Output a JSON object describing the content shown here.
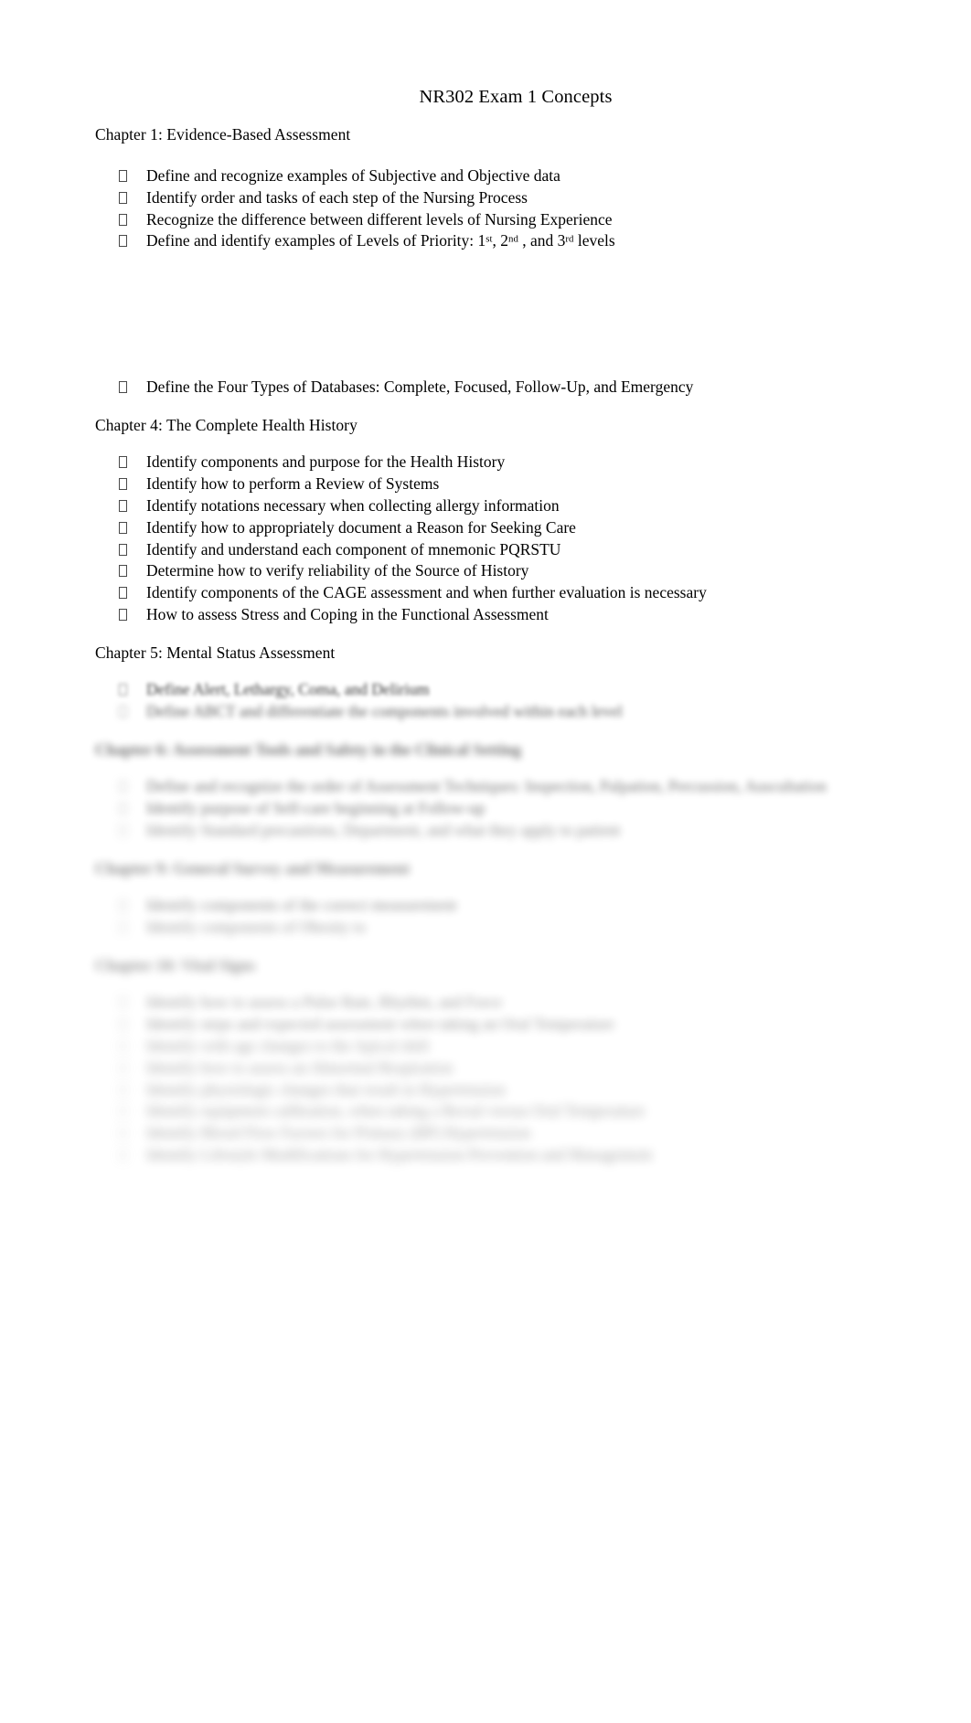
{
  "document": {
    "title": "NR302 Exam 1 Concepts",
    "bullet_glyph": "empty-box-glyph"
  },
  "sections": {
    "chapter1": {
      "heading": "Chapter 1: Evidence-Based Assessment",
      "bullets": [
        "Define and recognize examples of Subjective and Objective data",
        "Identify order and tasks of each step of the Nursing Process",
        "Recognize the difference between different levels of Nursing Experience"
      ],
      "priority_bullet": {
        "lead": "Define and identify examples of Levels of Priority: 1",
        "sup1": "st",
        "mid1": ", 2",
        "sup2": "nd",
        "mid2": " , and 3",
        "sup3": "rd",
        "tail": " levels"
      },
      "databases_bullet": "Define the Four Types of Databases: Complete, Focused, Follow-Up, and Emergency"
    },
    "chapter4": {
      "heading": "Chapter 4: The Complete Health History",
      "bullets": [
        "Identify components and purpose for the Health History",
        "Identify how to perform a Review of Systems",
        "Identify notations necessary when collecting allergy information",
        "Identify how to appropriately document a Reason for Seeking Care",
        "Identify and understand each component of mnemonic PQRSTU",
        "Determine how to verify reliability of the Source of History",
        "Identify components of the CAGE assessment and when further evaluation is necessary",
        "How to assess Stress and Coping in the Functional Assessment"
      ]
    },
    "chapter5": {
      "heading": "Chapter 5: Mental Status Assessment",
      "bullets": [
        "Define Alert, Lethargy, Coma, and Delirium",
        "Define ABCT and differentiate the components involved within each level"
      ]
    },
    "chapter6": {
      "heading": "Chapter 6: Assessment Tools and Safety in the Clinical Setting",
      "bullets": [
        "Define and recognize the order of Assessment Techniques: Inspection, Palpation, Percussion, Auscultation",
        "Identify purpose of Self-care beginning at Follow-up",
        "Identify Standard precautions, Department, and what they apply to patient"
      ]
    },
    "chapter9": {
      "heading": "Chapter 9: General Survey and Measurement",
      "bullets": [
        "Identify components of the correct measurement",
        "Identify components of Obesity to"
      ]
    },
    "chapter10": {
      "heading": "Chapter 10: Vital Signs",
      "bullets": [
        "Identify how to assess a Pulse Rate, Rhythm, and Force",
        "Identify steps and expected assessment when taking an Oral Temperature",
        "Identify with age changes to the Apical shift",
        "Identify how to assess an Abnormal Respiration",
        "Identify physiologic changes that result in Hypertension",
        "Identify equipment calibration, when taking a Rectal versus Oral Temperature",
        "Identify Blood Flow Factors for Primary (BP) Hypertension",
        "Identify Lifestyle Modifications for Hypertension Prevention and Management"
      ]
    }
  }
}
